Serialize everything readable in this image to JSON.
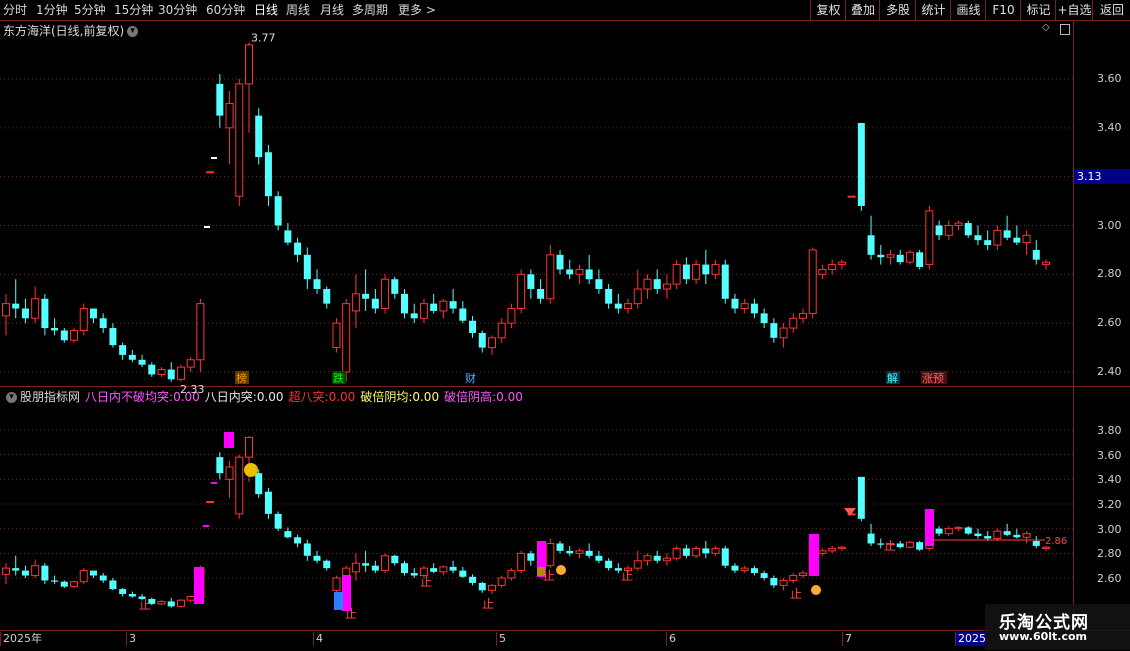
{
  "toolbar": {
    "periods": [
      "分时",
      "1分钟",
      "5分钟",
      "15分钟",
      "30分钟",
      "60分钟",
      "日线",
      "周线",
      "月线",
      "多周期",
      "更多 >"
    ],
    "active_period": "日线",
    "right_buttons": [
      "复权",
      "叠加",
      "多股",
      "统计",
      "画线",
      "F10",
      "标记",
      "+自选",
      "返回"
    ]
  },
  "main_panel": {
    "title": "东方海洋(日线,前复权)",
    "price_labels": [
      "3.60",
      "3.40",
      "3.20",
      "3.00",
      "2.80",
      "2.60",
      "2.40"
    ],
    "current_price": "3.13",
    "high_mark": "3.77",
    "low_mark": "2.33",
    "signal_tags": [
      {
        "text": "榜",
        "color": "#ff9900",
        "bg": "#5a3a00"
      },
      {
        "text": "跌",
        "color": "#00ff00",
        "bg": "#004400"
      },
      {
        "text": "财",
        "color": "#4ab0ff",
        "bg": "#000000"
      },
      {
        "text": "解",
        "color": "#44ffff",
        "bg": "#003344"
      },
      {
        "text": "涨预",
        "color": "#ff6060",
        "bg": "#4a1010"
      }
    ]
  },
  "indicator_panel": {
    "name": "股朋指标网",
    "items": [
      {
        "label": "八日内不破均突:",
        "value": "0.00",
        "color": "#ff55ff"
      },
      {
        "label": "八日内突:",
        "value": "0.00",
        "color": "#e8e8e8"
      },
      {
        "label": "超八突:",
        "value": "0.00",
        "color": "#ff3030"
      },
      {
        "label": "破倍阴均:",
        "value": "0.00",
        "color": "#ffff66"
      },
      {
        "label": "破倍阴高:",
        "value": "0.00",
        "color": "#ff55ff"
      }
    ],
    "price_labels": [
      "3.80",
      "3.60",
      "3.40",
      "3.20",
      "3.00",
      "2.80",
      "2.60"
    ],
    "line_value": "2.86",
    "stop_label": "止"
  },
  "date_axis": [
    "2025年",
    "3",
    "4",
    "5",
    "6",
    "7",
    "2025"
  ],
  "watermark": {
    "title": "乐淘公式网",
    "url": "www.60lt.com"
  },
  "colors": {
    "up": "#ff3232",
    "down": "#54ffff",
    "grid": "#7a1f1f",
    "magenta": "#ff00ff"
  },
  "chart_data": {
    "type": "candlestick",
    "series": [
      {
        "name": "东方海洋",
        "ohlc": [
          [
            2.63,
            2.72,
            2.55,
            2.68
          ],
          [
            2.68,
            2.78,
            2.62,
            2.66
          ],
          [
            2.66,
            2.7,
            2.6,
            2.62
          ],
          [
            2.62,
            2.75,
            2.6,
            2.7
          ],
          [
            2.7,
            2.72,
            2.55,
            2.58
          ],
          [
            2.58,
            2.62,
            2.55,
            2.57
          ],
          [
            2.57,
            2.58,
            2.52,
            2.53
          ],
          [
            2.53,
            2.58,
            2.52,
            2.57
          ],
          [
            2.57,
            2.68,
            2.55,
            2.66
          ],
          [
            2.66,
            2.66,
            2.6,
            2.62
          ],
          [
            2.62,
            2.64,
            2.56,
            2.58
          ],
          [
            2.58,
            2.6,
            2.5,
            2.51
          ],
          [
            2.51,
            2.52,
            2.45,
            2.47
          ],
          [
            2.47,
            2.49,
            2.44,
            2.45
          ],
          [
            2.45,
            2.47,
            2.42,
            2.43
          ],
          [
            2.43,
            2.44,
            2.38,
            2.39
          ],
          [
            2.39,
            2.42,
            2.38,
            2.41
          ],
          [
            2.41,
            2.44,
            2.36,
            2.37
          ],
          [
            2.37,
            2.43,
            2.36,
            2.42
          ],
          [
            2.42,
            2.46,
            2.4,
            2.45
          ],
          [
            2.45,
            2.7,
            2.4,
            2.68
          ],
          [
            3.22,
            3.22,
            3.22,
            3.22
          ],
          [
            3.58,
            3.62,
            3.4,
            3.45
          ],
          [
            3.4,
            3.55,
            3.25,
            3.5
          ],
          [
            3.12,
            3.6,
            3.08,
            3.58
          ],
          [
            3.58,
            3.75,
            3.38,
            3.74
          ],
          [
            3.45,
            3.48,
            3.25,
            3.28
          ],
          [
            3.3,
            3.33,
            3.08,
            3.12
          ],
          [
            3.12,
            3.14,
            2.98,
            3.0
          ],
          [
            2.98,
            3.01,
            2.92,
            2.93
          ],
          [
            2.93,
            2.95,
            2.85,
            2.88
          ],
          [
            2.88,
            2.91,
            2.74,
            2.78
          ],
          [
            2.78,
            2.82,
            2.72,
            2.74
          ],
          [
            2.74,
            2.75,
            2.66,
            2.68
          ],
          [
            2.5,
            2.62,
            2.48,
            2.6
          ],
          [
            2.4,
            2.7,
            2.36,
            2.68
          ],
          [
            2.65,
            2.8,
            2.58,
            2.72
          ],
          [
            2.72,
            2.82,
            2.65,
            2.7
          ],
          [
            2.7,
            2.74,
            2.64,
            2.66
          ],
          [
            2.66,
            2.8,
            2.64,
            2.78
          ],
          [
            2.78,
            2.79,
            2.7,
            2.72
          ],
          [
            2.72,
            2.74,
            2.62,
            2.64
          ],
          [
            2.64,
            2.68,
            2.6,
            2.62
          ],
          [
            2.62,
            2.7,
            2.6,
            2.68
          ],
          [
            2.68,
            2.72,
            2.64,
            2.65
          ],
          [
            2.65,
            2.7,
            2.62,
            2.69
          ],
          [
            2.69,
            2.74,
            2.64,
            2.66
          ],
          [
            2.66,
            2.69,
            2.6,
            2.61
          ],
          [
            2.61,
            2.63,
            2.54,
            2.56
          ],
          [
            2.56,
            2.57,
            2.48,
            2.5
          ],
          [
            2.5,
            2.55,
            2.47,
            2.54
          ],
          [
            2.54,
            2.62,
            2.52,
            2.6
          ],
          [
            2.6,
            2.68,
            2.58,
            2.66
          ],
          [
            2.66,
            2.82,
            2.64,
            2.8
          ],
          [
            2.8,
            2.82,
            2.7,
            2.74
          ],
          [
            2.74,
            2.78,
            2.68,
            2.7
          ],
          [
            2.7,
            2.92,
            2.68,
            2.88
          ],
          [
            2.88,
            2.9,
            2.8,
            2.82
          ],
          [
            2.82,
            2.86,
            2.78,
            2.8
          ],
          [
            2.8,
            2.84,
            2.76,
            2.82
          ],
          [
            2.82,
            2.88,
            2.76,
            2.78
          ],
          [
            2.78,
            2.82,
            2.72,
            2.74
          ],
          [
            2.74,
            2.76,
            2.66,
            2.68
          ],
          [
            2.68,
            2.72,
            2.64,
            2.66
          ],
          [
            2.66,
            2.7,
            2.64,
            2.68
          ],
          [
            2.68,
            2.82,
            2.66,
            2.74
          ],
          [
            2.74,
            2.8,
            2.7,
            2.78
          ],
          [
            2.78,
            2.82,
            2.72,
            2.74
          ],
          [
            2.74,
            2.8,
            2.7,
            2.76
          ],
          [
            2.76,
            2.86,
            2.74,
            2.84
          ],
          [
            2.84,
            2.87,
            2.76,
            2.78
          ],
          [
            2.78,
            2.86,
            2.76,
            2.84
          ],
          [
            2.84,
            2.9,
            2.76,
            2.8
          ],
          [
            2.8,
            2.86,
            2.78,
            2.84
          ],
          [
            2.84,
            2.86,
            2.68,
            2.7
          ],
          [
            2.7,
            2.72,
            2.64,
            2.66
          ],
          [
            2.66,
            2.7,
            2.64,
            2.68
          ],
          [
            2.68,
            2.7,
            2.62,
            2.64
          ],
          [
            2.64,
            2.66,
            2.58,
            2.6
          ],
          [
            2.6,
            2.62,
            2.52,
            2.54
          ],
          [
            2.54,
            2.6,
            2.5,
            2.58
          ],
          [
            2.58,
            2.64,
            2.56,
            2.62
          ],
          [
            2.62,
            2.66,
            2.6,
            2.64
          ],
          [
            2.64,
            2.91,
            2.62,
            2.9
          ],
          [
            2.8,
            2.84,
            2.78,
            2.82
          ],
          [
            2.82,
            2.86,
            2.8,
            2.84
          ],
          [
            2.84,
            2.86,
            2.82,
            2.85
          ],
          [
            3.12,
            3.12,
            3.12,
            3.12
          ],
          [
            3.42,
            3.42,
            3.06,
            3.08
          ],
          [
            2.96,
            3.04,
            2.86,
            2.88
          ],
          [
            2.88,
            2.92,
            2.84,
            2.87
          ],
          [
            2.87,
            2.9,
            2.84,
            2.88
          ],
          [
            2.88,
            2.9,
            2.84,
            2.85
          ],
          [
            2.85,
            2.9,
            2.84,
            2.89
          ],
          [
            2.89,
            2.9,
            2.82,
            2.83
          ],
          [
            2.84,
            3.08,
            2.82,
            3.06
          ],
          [
            3.0,
            3.02,
            2.94,
            2.96
          ],
          [
            2.96,
            3.02,
            2.94,
            3.0
          ],
          [
            3.0,
            3.02,
            2.98,
            3.01
          ],
          [
            3.01,
            3.02,
            2.95,
            2.96
          ],
          [
            2.96,
            3.0,
            2.92,
            2.94
          ],
          [
            2.94,
            2.98,
            2.9,
            2.92
          ],
          [
            2.92,
            3.0,
            2.9,
            2.98
          ],
          [
            2.98,
            3.04,
            2.94,
            2.95
          ],
          [
            2.95,
            3.0,
            2.92,
            2.93
          ],
          [
            2.93,
            2.98,
            2.88,
            2.96
          ],
          [
            2.9,
            2.94,
            2.84,
            2.86
          ],
          [
            2.84,
            2.86,
            2.82,
            2.85
          ]
        ]
      }
    ],
    "y_range_main": [
      2.33,
      3.77
    ],
    "y_range_indicator": [
      2.5,
      3.85
    ],
    "xlabel": "",
    "ylabel": ""
  }
}
